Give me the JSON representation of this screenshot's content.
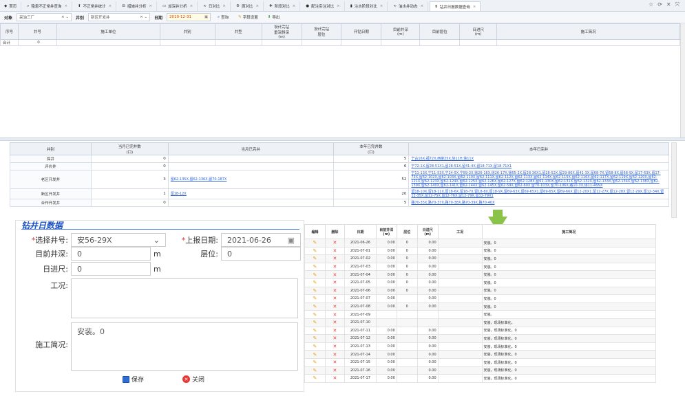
{
  "tabs": [
    {
      "label": "首页",
      "icon": "home-icon"
    },
    {
      "label": "隐患不正常井查询",
      "icon": "search-icon"
    },
    {
      "label": "不正常井统计",
      "icon": "arrow-up-icon"
    },
    {
      "label": "措施井分析",
      "icon": "minus-icon"
    },
    {
      "label": "加深井分析",
      "icon": "box-icon"
    },
    {
      "label": "日对比",
      "icon": "binoculars-icon"
    },
    {
      "label": "周对比",
      "icon": "gear-icon"
    },
    {
      "label": "阶段对比",
      "icon": "plus-icon"
    },
    {
      "label": "配注实注对比",
      "icon": "dot-icon"
    },
    {
      "label": "注水阶段对比",
      "icon": "bar-icon"
    },
    {
      "label": "油水井动态",
      "icon": "binoculars-icon"
    },
    {
      "label": "钻井日报数据查询",
      "icon": "arrow-up-icon",
      "active": true
    }
  ],
  "filter": {
    "object_label": "对象",
    "object_value": "采油三厂",
    "well_label": "井别",
    "well_value": "新区开发井",
    "date_label": "日期",
    "date_value": "2019-12-31",
    "query_label": "查询",
    "fields_label": "字段设置",
    "export_label": "导出"
  },
  "grid1": {
    "headers": [
      "序号",
      "井号",
      "施工单位",
      "井别",
      "井型",
      "设计完钻\n垂深斜深\n(m)",
      "设计完钻\n层位",
      "开钻日期",
      "目前井深\n(m)",
      "目前层位",
      "日进尺\n(m)",
      "施工简况"
    ],
    "total_row": [
      "合计",
      "0"
    ]
  },
  "grid2": {
    "headers": [
      "井别",
      "当月已完井数\n(口)",
      "当月已完井",
      "本年已完井数\n(口)",
      "本年已完井"
    ],
    "rows": [
      {
        "type": "探井",
        "month_count": "0",
        "month_wells": "",
        "year_count": "5",
        "year_wells": "宁古16X,福72X,西柳25X,徐11H,徐11X"
      },
      {
        "type": "评价井",
        "month_count": "0",
        "month_wells": "",
        "year_count": "6",
        "year_wells": "宁72-1X,留28-51X1,留28-51X,留41-4X,留18-71X,留18-71X1"
      },
      {
        "type": "老区开发井",
        "month_count": "3",
        "month_wells": "留62-135X,留62-136X,留70-187X",
        "year_count": "52",
        "year_wells": "宁11-13X,宁11-53X,宁24-5X,宁89-2X,徐26-16X,徐26-17X,徐65-2X,留28-36X1,留28-52X,留29-80X,留41-3X,留68-7X,留68-8X,留68-9X,留17-63X,留17-73X,留62-102X,留62-103X,留62-110X,留62-111X,留62-112X,留62-113X,留62-114X,留62-115X,留62-116X,留62-117X,留62-119X,留62-120X,留62-121X,留62-123X,留62-124X,留62-125X,留62-126X,留62-127X,留62-128X,留62-130X,留62-131X,留62-132X,留62-133X,留62-134X,留62-138X,留62-139X,留62-140X,留62-141X,留62-144X,留62-145X,留62-59X,留62-60X,留70-103X,留70-106X,路10-3X,徐11-46NX"
      },
      {
        "type": "新区开发井",
        "month_count": "1",
        "month_wells": "留18-12X",
        "year_count": "20",
        "year_wells": "留18-10X,留18-11X,留18-6X,留18-7X,留18-8X,留18-9X,留69-63X,留69-65X1,留69-65X,留69-66X,留12-20X1,留12-27X,留12-28X,留12-29X,留12-34X,留12-35X,留12-75X,留12-76X,留12-79X,留12-79X1"
      },
      {
        "type": "合作开发井",
        "month_count": "0",
        "month_wells": "",
        "year_count": "5",
        "year_wells": "路70-35X,路70-37X,路70-38X,路70-39X,路70-40X"
      }
    ]
  },
  "form": {
    "title": "钻井日数据",
    "well_label": "选择井号:",
    "well_value": "安56-29X",
    "date_label": "上报日期:",
    "date_value": "2021-06-26",
    "depth_label": "目前井深:",
    "depth_value": "0",
    "depth_unit": "m",
    "layer_label": "层位:",
    "layer_value": "0",
    "footage_label": "日进尺:",
    "footage_value": "0",
    "footage_unit": "m",
    "condition_label": "工况:",
    "condition_value": "",
    "summary_label": "施工简况:",
    "summary_value": "安装。0",
    "save_label": "保存",
    "close_label": "关闭"
  },
  "rtable": {
    "headers": [
      "编辑",
      "删除",
      "日期",
      "目前井深\n(m)",
      "层位",
      "日进尺\n(m)",
      "工况",
      "施工简况"
    ],
    "rows": [
      {
        "date": "2021-06-26",
        "depth": "0.00",
        "layer": "0",
        "footage": "0.00",
        "summary": "安装。0"
      },
      {
        "date": "2021-07-01",
        "depth": "0.00",
        "layer": "0",
        "footage": "0.00",
        "summary": "安装。0"
      },
      {
        "date": "2021-07-02",
        "depth": "0.00",
        "layer": "0",
        "footage": "0.00",
        "summary": "安装。0"
      },
      {
        "date": "2021-07-03",
        "depth": "0.00",
        "layer": "0",
        "footage": "0.00",
        "summary": "安装。0"
      },
      {
        "date": "2021-07-04",
        "depth": "0.00",
        "layer": "0",
        "footage": "0.00",
        "summary": "安装。0"
      },
      {
        "date": "2021-07-05",
        "depth": "0.00",
        "layer": "0",
        "footage": "0.00",
        "summary": "安装。0"
      },
      {
        "date": "2021-07-06",
        "depth": "0.00",
        "layer": "0",
        "footage": "0.00",
        "summary": "安装。0"
      },
      {
        "date": "2021-07-07",
        "depth": "0.00",
        "layer": "",
        "footage": "0.00",
        "summary": "安装。0"
      },
      {
        "date": "2021-07-08",
        "depth": "0.00",
        "layer": "0",
        "footage": "0.00",
        "summary": "安装。0"
      },
      {
        "date": "2021-07-09",
        "depth": "",
        "layer": "",
        "footage": "",
        "summary": "安装。"
      },
      {
        "date": "2021-07-10",
        "depth": "",
        "layer": "",
        "footage": "",
        "summary": "安装，现场标准化。"
      },
      {
        "date": "2021-07-11",
        "depth": "0.00",
        "layer": "",
        "footage": "0.00",
        "summary": "安装，现场标准化。0"
      },
      {
        "date": "2021-07-12",
        "depth": "0.00",
        "layer": "",
        "footage": "0.00",
        "summary": "安装，现场标准化。0"
      },
      {
        "date": "2021-07-13",
        "depth": "0.00",
        "layer": "",
        "footage": "0.00",
        "summary": "安装，现场标准化。0"
      },
      {
        "date": "2021-07-14",
        "depth": "0.00",
        "layer": "",
        "footage": "0.00",
        "summary": "安装，现场标准化。0"
      },
      {
        "date": "2021-07-15",
        "depth": "0.00",
        "layer": "",
        "footage": "0.00",
        "summary": "安装，现场标准化。0"
      },
      {
        "date": "2021-07-16",
        "depth": "0.00",
        "layer": "",
        "footage": "0.00",
        "summary": "安装，现场标准化。0"
      },
      {
        "date": "2021-07-17",
        "depth": "0.00",
        "layer": "",
        "footage": "0.00",
        "summary": "安装，现场标准化。0"
      }
    ]
  },
  "colors": {
    "accent": "#2a5fd8",
    "danger": "#e53935",
    "arrow": "#8bc34a"
  }
}
